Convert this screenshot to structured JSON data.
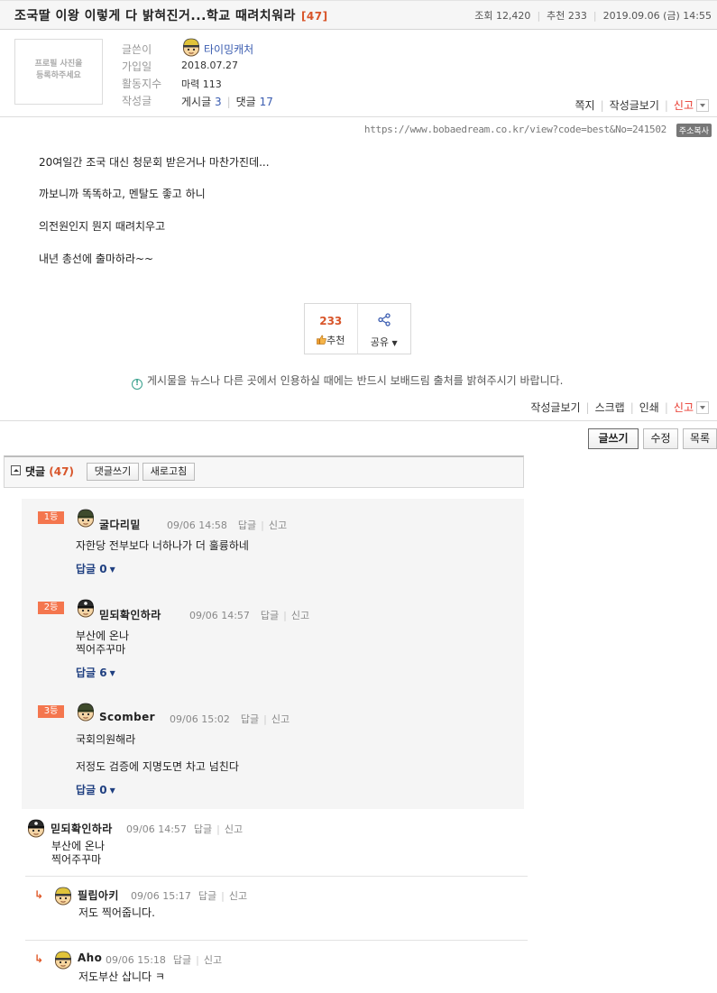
{
  "post": {
    "title": "조국딸 이왕 이렇게 다 밝혀진거...학교 때려치워라",
    "comment_count_label": "[47]",
    "views": "조회 12,420",
    "recommends": "추천 233",
    "date": "2019.09.06 (금) 14:55"
  },
  "profile": {
    "placeholder_line1": "프로필 사진을",
    "placeholder_line2": "등록하주세요",
    "labels": {
      "writer": "글쓴이",
      "joined": "가입일",
      "activity": "활동지수",
      "posts": "작성글"
    },
    "writer_name": "타이밍캐처",
    "joined_date": "2018.07.27",
    "activity_value": "마력 113",
    "posts_label": "게시글",
    "posts_count": "3",
    "comments_label": "댓글",
    "comments_count": "17",
    "actions": {
      "message": "쪽지",
      "view_posts": "작성글보기",
      "report": "신고"
    }
  },
  "url": {
    "text": "https://www.bobaedream.co.kr/view?code=best&No=241502",
    "copy_label": "주소복사"
  },
  "body": {
    "lines": [
      "20여일간 조국 대신 청문회 받은거나 마찬가진데...",
      "까보니까 똑똑하고, 멘탈도 좋고 하니",
      "의전원인지 뭔지 때려치우고",
      "내년 총선에 출마하라~~"
    ]
  },
  "recommend": {
    "count": "233",
    "label": "추천",
    "share_label": "공유"
  },
  "notice": "게시물을 뉴스나 다른 곳에서 인용하실 때에는 반드시 보배드림 출처를 밝혀주시기 바랍니다.",
  "bottom_actions": {
    "view_posts": "작성글보기",
    "scrap": "스크랩",
    "print": "인쇄",
    "report": "신고"
  },
  "buttons": {
    "write": "글쓰기",
    "edit": "수정",
    "list": "목록"
  },
  "comments_header": {
    "title": "댓글",
    "count": "(47)",
    "write_btn": "댓글쓰기",
    "refresh_btn": "새로고침"
  },
  "labels": {
    "reply": "답글",
    "report": "신고"
  },
  "best_comments": [
    {
      "rank": "1등",
      "nick": "굴다리밑",
      "time": "09/06 14:58",
      "lines": [
        "자한당 전부보다 너하나가 더 훌륭하네"
      ],
      "replies": "답글 0"
    },
    {
      "rank": "2등",
      "nick": "믿되확인하라",
      "time": "09/06 14:57",
      "lines": [
        "부산에 온나",
        "찍어주꾸마"
      ],
      "replies": "답글 6"
    },
    {
      "rank": "3등",
      "nick": "Scomber",
      "time": "09/06 15:02",
      "lines": [
        "국회의원해라",
        "저정도 검증에 지명도면 차고 넘친다"
      ],
      "replies": "답글 0"
    }
  ],
  "comments": [
    {
      "nick": "믿되확인하라",
      "time": "09/06 14:57",
      "lines": [
        "부산에 온나",
        "찍어주꾸마"
      ]
    },
    {
      "nick": "필립아키",
      "time": "09/06 15:17",
      "lines": [
        "저도 찍어줍니다."
      ],
      "is_reply": true
    },
    {
      "nick": "Aho",
      "time": "09/06 15:18",
      "lines": [
        "저도부산 삽니다 ㅋ"
      ],
      "is_reply": true
    }
  ],
  "colors": {
    "accent": "#d8552a",
    "rank_bg": "#f4764e",
    "link_blue": "#3a5cb0",
    "report_red": "#e8372c"
  }
}
